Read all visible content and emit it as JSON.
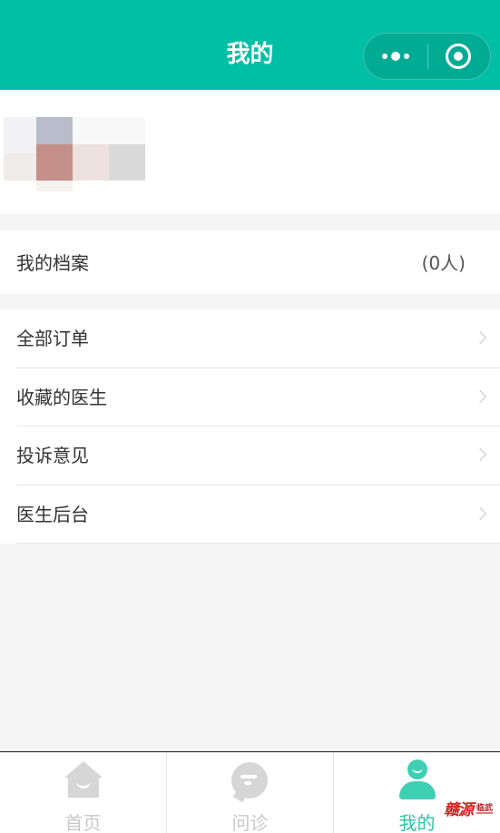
{
  "header": {
    "title": "我的"
  },
  "profile": {
    "avatar": "blurred-avatar"
  },
  "archive": {
    "label": "我的档案",
    "count": "(0人)"
  },
  "menu": {
    "items": [
      {
        "label": "全部订单"
      },
      {
        "label": "收藏的医生"
      },
      {
        "label": "投诉意见"
      },
      {
        "label": "医生后台"
      }
    ]
  },
  "tabbar": {
    "tabs": [
      {
        "label": "首页",
        "icon": "home-icon"
      },
      {
        "label": "问诊",
        "icon": "chat-icon"
      },
      {
        "label": "我的",
        "icon": "user-icon"
      }
    ],
    "active": "我的"
  },
  "watermark": {
    "text": "赣源",
    "sub": "临武"
  },
  "colors": {
    "brand": "#00bfa5",
    "tab_active": "#2fc4a6",
    "tab_inactive": "#c8c8c8",
    "background": "#f5f5f5"
  }
}
